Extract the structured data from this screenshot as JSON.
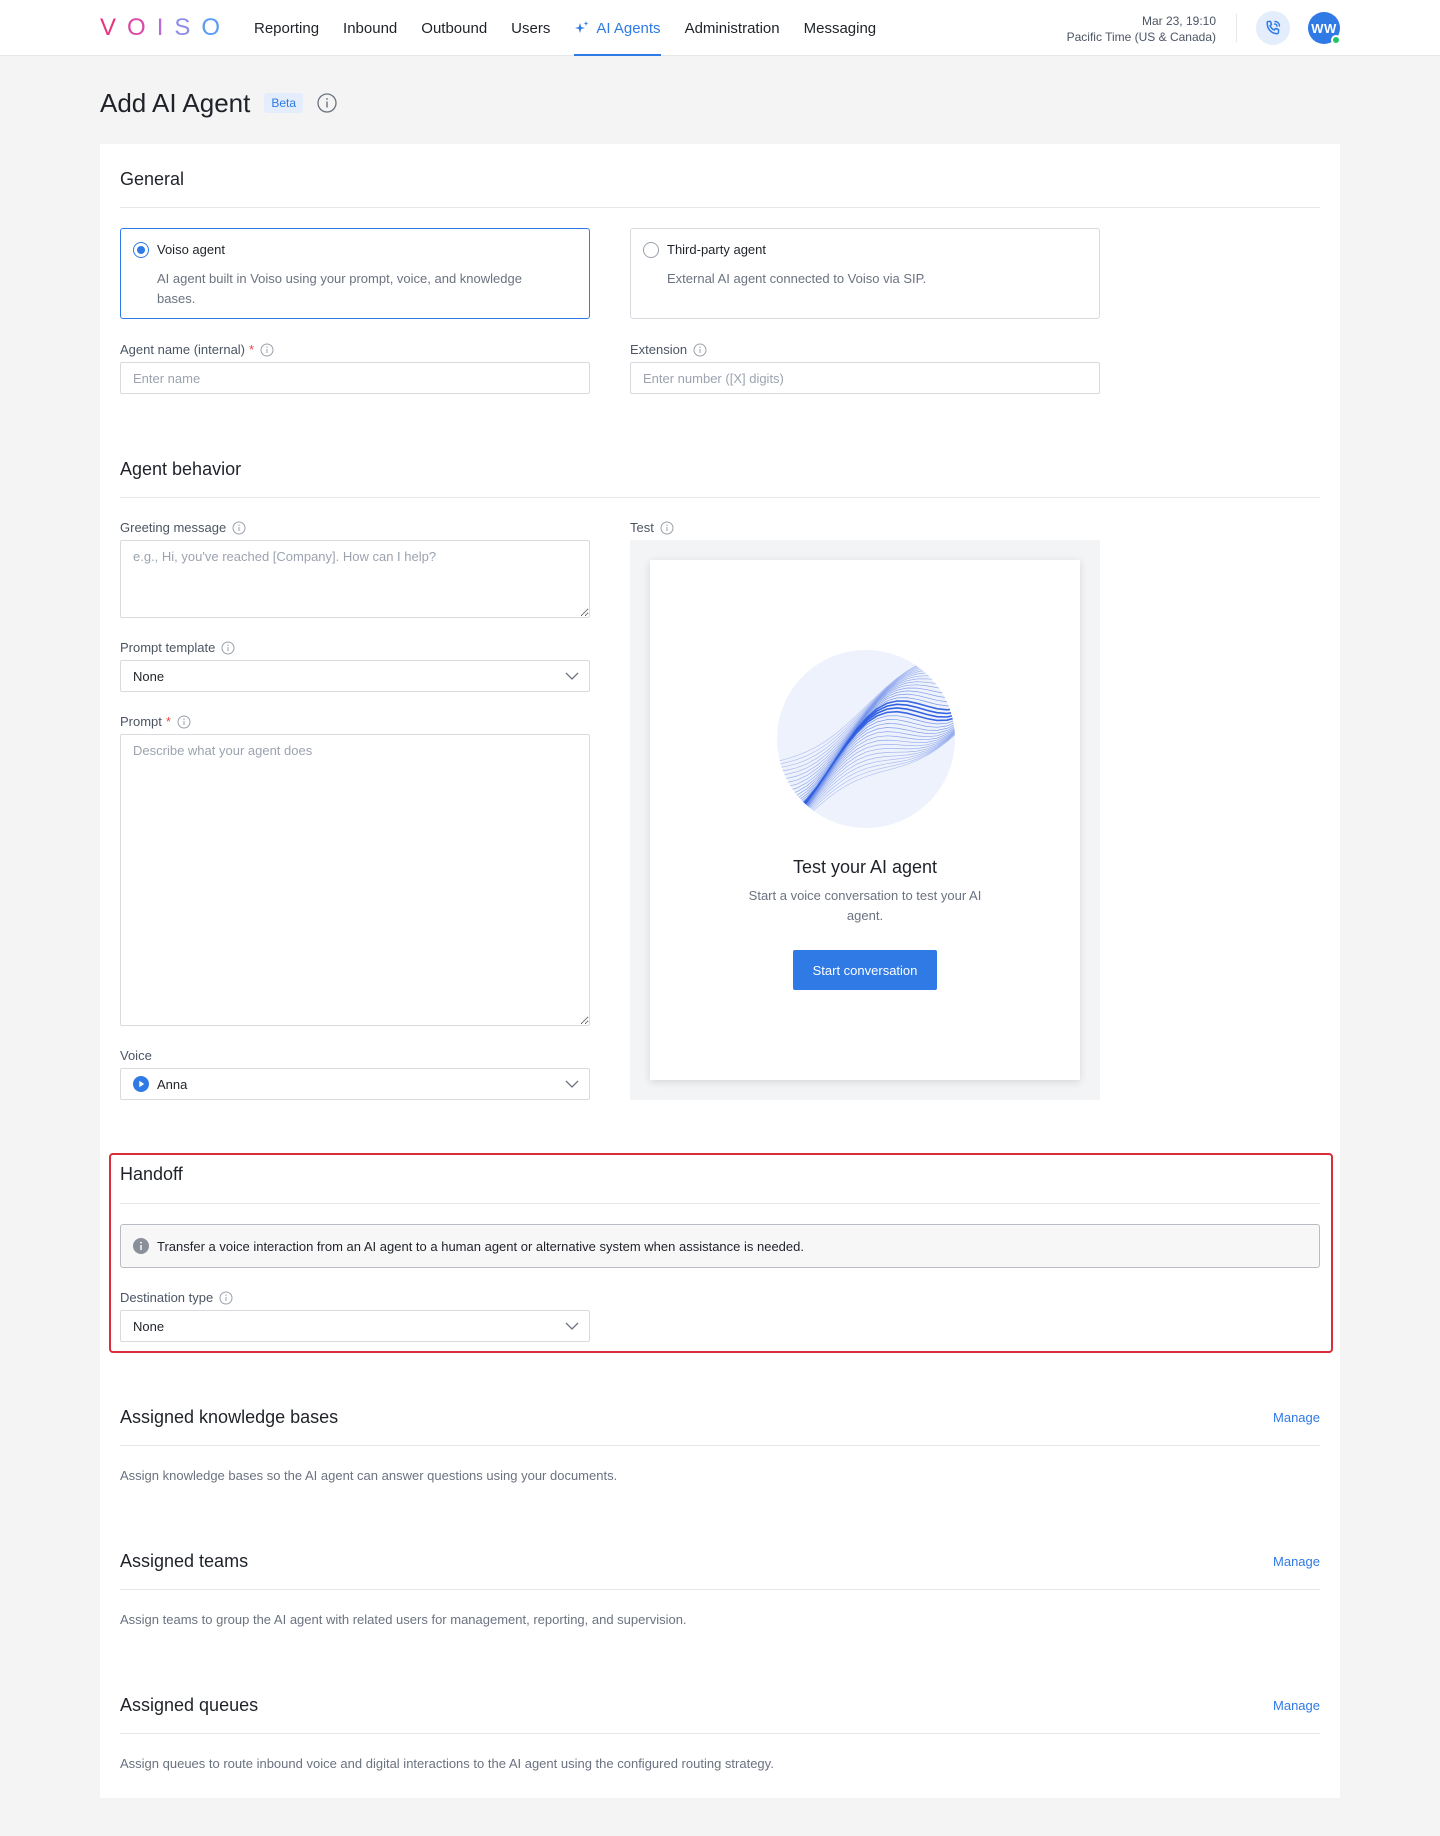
{
  "nav": {
    "logo": [
      "V",
      "O",
      "I",
      "S",
      "O"
    ],
    "logo_colors": [
      "#e8347c",
      "#d94aa8",
      "#b86bd6",
      "#8f8de8",
      "#5b9bf0"
    ],
    "items": [
      {
        "label": "Reporting"
      },
      {
        "label": "Inbound"
      },
      {
        "label": "Outbound"
      },
      {
        "label": "Users"
      },
      {
        "label": "AI Agents",
        "active": true
      },
      {
        "label": "Administration"
      },
      {
        "label": "Messaging"
      }
    ],
    "datetime": "Mar 23, 19:10",
    "timezone": "Pacific Time (US & Canada)",
    "avatar_initials": "WW"
  },
  "page": {
    "title": "Add AI Agent",
    "badge": "Beta"
  },
  "general": {
    "title": "General",
    "options": [
      {
        "title": "Voiso agent",
        "desc": "AI agent built in Voiso using your prompt, voice, and knowledge bases.",
        "selected": true
      },
      {
        "title": "Third-party agent",
        "desc": "External AI agent connected to Voiso via SIP.",
        "selected": false
      }
    ],
    "agent_name_label": "Agent name (internal)",
    "agent_name_placeholder": "Enter name",
    "extension_label": "Extension",
    "extension_placeholder": "Enter number ([X] digits)"
  },
  "behavior": {
    "title": "Agent behavior",
    "greeting_label": "Greeting message",
    "greeting_placeholder": "e.g., Hi, you've reached [Company]. How can I help?",
    "prompt_template_label": "Prompt template",
    "prompt_template_value": "None",
    "prompt_label": "Prompt",
    "prompt_placeholder": "Describe what your agent does",
    "voice_label": "Voice",
    "voice_value": "Anna",
    "test_label": "Test",
    "test_title": "Test your AI agent",
    "test_desc": "Start a voice conversation to test your AI agent.",
    "start_button": "Start conversation"
  },
  "handoff": {
    "title": "Handoff",
    "info": "Transfer a voice interaction from an AI agent to a human agent or alternative system when assistance is needed.",
    "destination_label": "Destination type",
    "destination_value": "None"
  },
  "knowledge": {
    "title": "Assigned knowledge bases",
    "manage": "Manage",
    "desc": "Assign knowledge bases so the AI agent can answer questions using your documents."
  },
  "teams": {
    "title": "Assigned teams",
    "manage": "Manage",
    "desc": "Assign teams to group the AI agent with related users for management, reporting, and supervision."
  },
  "queues": {
    "title": "Assigned queues",
    "manage": "Manage",
    "desc": "Assign queues to route inbound voice and digital interactions to the AI agent using the configured routing strategy."
  },
  "colors": {
    "accent": "#2f7ae5",
    "handoff_highlight": "#d92d3a",
    "required": "#e54848",
    "online": "#22c55e"
  }
}
